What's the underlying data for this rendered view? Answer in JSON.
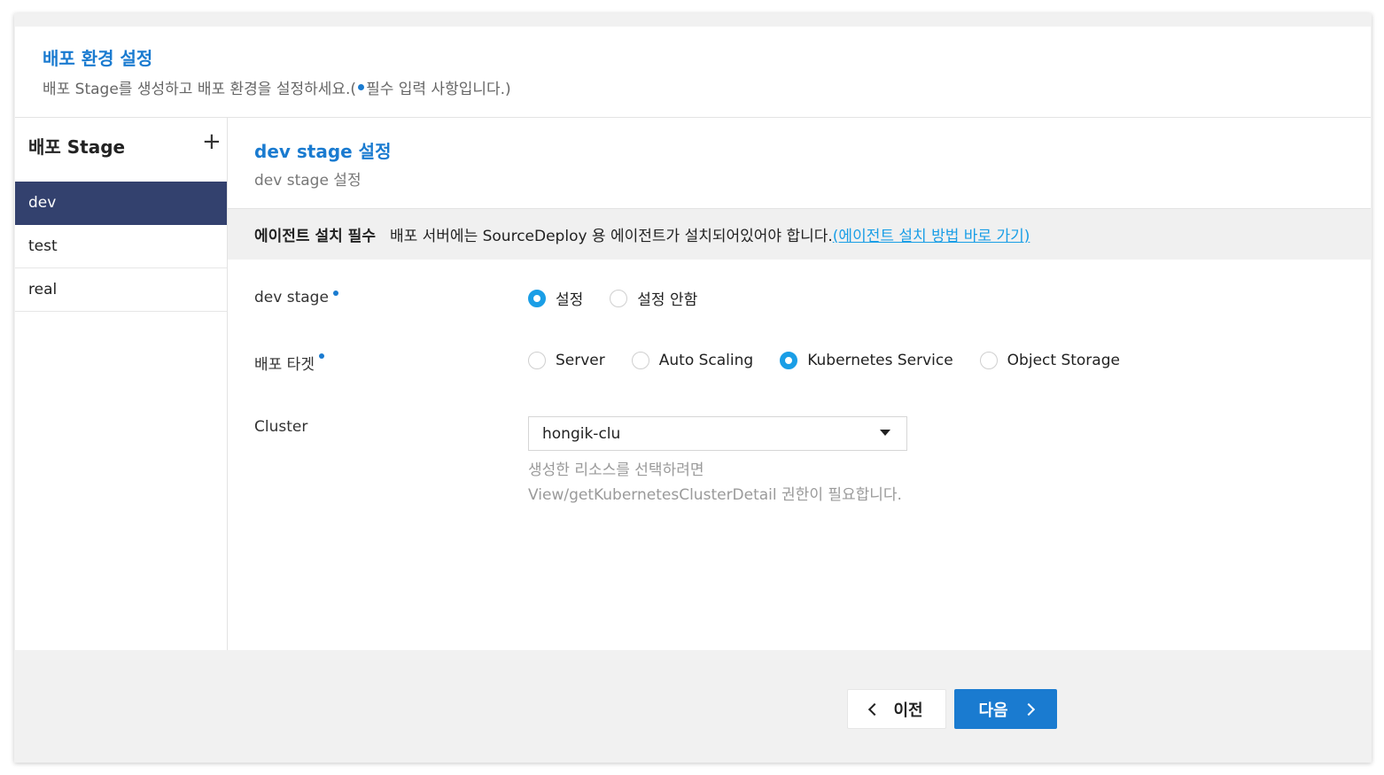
{
  "header": {
    "title": "배포 환경 설정",
    "desc_prefix": "배포 Stage를 생성하고 배포 환경을 설정하세요.(",
    "desc_suffix": "필수 입력 사항입니다.)"
  },
  "sidebar": {
    "title": "배포 Stage",
    "add_label": "+",
    "items": [
      {
        "label": "dev"
      },
      {
        "label": "test"
      },
      {
        "label": "real"
      }
    ]
  },
  "main": {
    "title": "dev stage 설정",
    "subtitle": "dev stage 설정",
    "notice": {
      "strong": "에이전트 설치 필수",
      "text": "배포 서버에는 SourceDeploy 용 에이전트가 설치되어있어야 합니다.",
      "link": "(에이전트 설치 방법 바로 가기)"
    },
    "stage_row": {
      "label": "dev stage",
      "options": [
        {
          "label": "설정",
          "selected": true
        },
        {
          "label": "설정 안함",
          "selected": false
        }
      ]
    },
    "target_row": {
      "label": "배포 타겟",
      "options": [
        {
          "label": "Server",
          "selected": false
        },
        {
          "label": "Auto Scaling",
          "selected": false
        },
        {
          "label": "Kubernetes Service",
          "selected": true
        },
        {
          "label": "Object Storage",
          "selected": false
        }
      ]
    },
    "cluster_row": {
      "label": "Cluster",
      "value": "hongik-clu",
      "hint_line1": "생성한 리소스를 선택하려면",
      "hint_line2": "View/getKubernetesClusterDetail 권한이 필요합니다."
    }
  },
  "footer": {
    "prev_label": "이전",
    "next_label": "다음"
  },
  "colors": {
    "accent": "#1a7bd0",
    "radio_on": "#1a9ee6",
    "sidebar_active": "#33416e"
  }
}
